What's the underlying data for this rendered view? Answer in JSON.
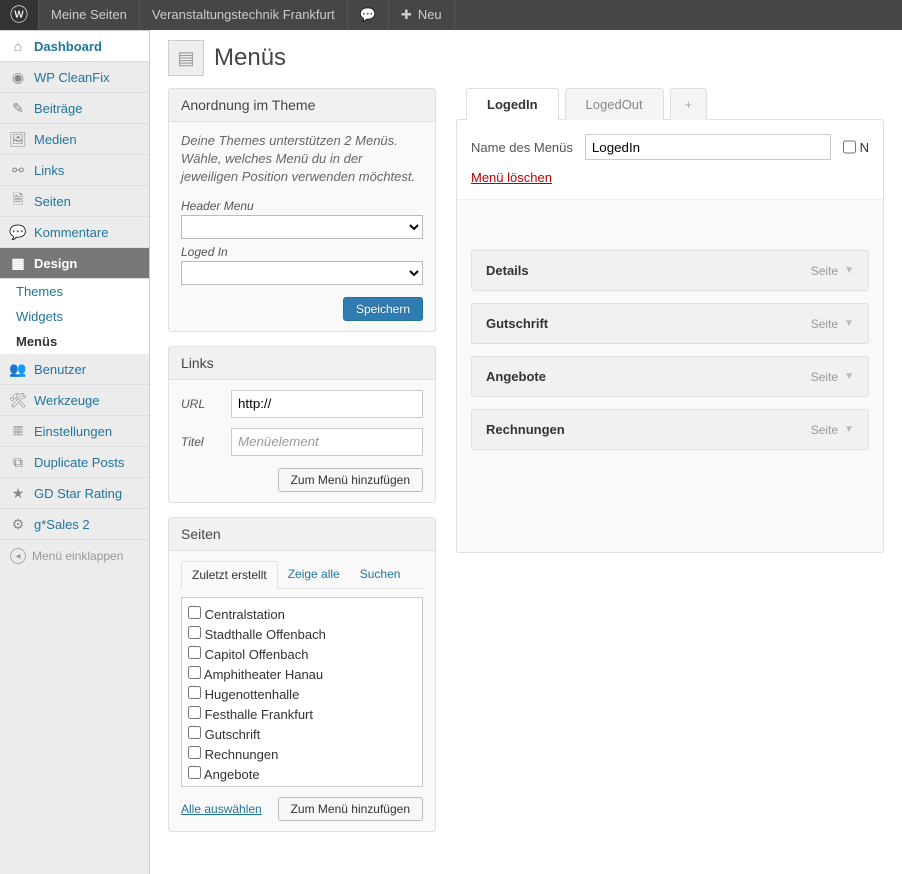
{
  "adminbar": {
    "my_sites": "Meine Seiten",
    "site_name": "Veranstaltungstechnik Frankfurt",
    "new": "Neu"
  },
  "sidebar": {
    "dashboard": "Dashboard",
    "cleanfix": "WP CleanFix",
    "posts": "Beiträge",
    "media": "Medien",
    "links": "Links",
    "pages": "Seiten",
    "comments": "Kommentare",
    "design": "Design",
    "design_sub": {
      "themes": "Themes",
      "widgets": "Widgets",
      "menus": "Menüs"
    },
    "users": "Benutzer",
    "tools": "Werkzeuge",
    "settings": "Einstellungen",
    "duplicate": "Duplicate Posts",
    "gdstar": "GD Star Rating",
    "gsales": "g*Sales 2",
    "collapse": "Menü einklappen"
  },
  "page": {
    "title": "Menüs"
  },
  "theme_box": {
    "heading": "Anordnung im Theme",
    "desc": "Deine Themes unterstützen 2 Menüs. Wähle, welches Menü du in der jeweiligen Position verwenden möchtest.",
    "loc1": "Header Menu",
    "loc2": "Loged In",
    "save": "Speichern"
  },
  "links_box": {
    "heading": "Links",
    "url_label": "URL",
    "url_value": "http://",
    "title_label": "Titel",
    "title_ph": "Menüelement",
    "add": "Zum Menü hinzufügen"
  },
  "pages_box": {
    "heading": "Seiten",
    "tab_recent": "Zuletzt erstellt",
    "tab_all": "Zeige alle",
    "tab_search": "Suchen",
    "items": [
      "Centralstation",
      "Stadthalle Offenbach",
      "Capitol Offenbach",
      "Amphitheater Hanau",
      "Hugenottenhalle",
      "Festhalle Frankfurt",
      "Gutschrift",
      "Rechnungen",
      "Angebote"
    ],
    "select_all": "Alle auswählen",
    "add": "Zum Menü hinzufügen"
  },
  "menu": {
    "tabs": [
      "LogedIn",
      "LogedOut"
    ],
    "active_tab": "LogedIn",
    "add_tab": "+",
    "name_label": "Name des Menüs",
    "name_value": "LogedIn",
    "checkbox_label": "N",
    "delete": "Menü löschen",
    "type": "Seite",
    "items": [
      "Details",
      "Gutschrift",
      "Angebote",
      "Rechnungen"
    ]
  }
}
